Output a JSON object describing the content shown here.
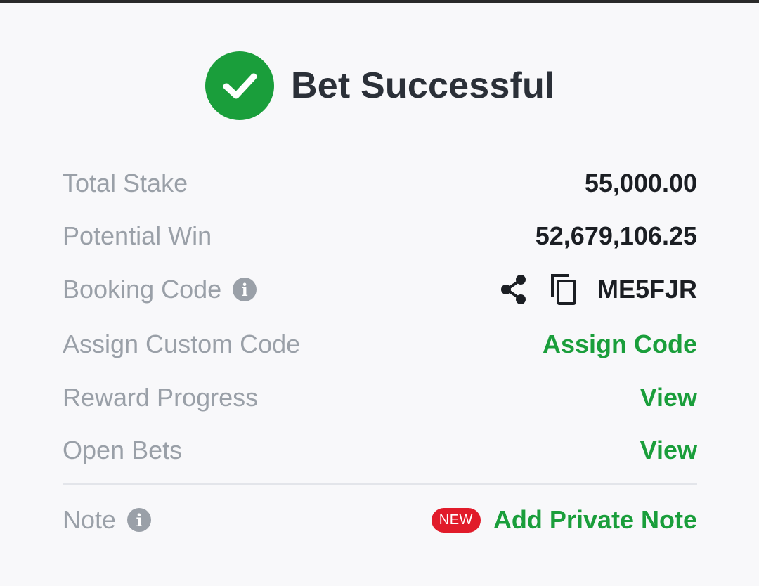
{
  "header": {
    "title": "Bet Successful"
  },
  "rows": {
    "total_stake": {
      "label": "Total Stake",
      "value": "55,000.00"
    },
    "potential_win": {
      "label": "Potential Win",
      "value": "52,679,106.25"
    },
    "booking_code": {
      "label": "Booking Code",
      "value": "ME5FJR"
    },
    "assign_custom_code": {
      "label": "Assign Custom Code",
      "action": "Assign Code"
    },
    "reward_progress": {
      "label": "Reward Progress",
      "action": "View"
    },
    "open_bets": {
      "label": "Open Bets",
      "action": "View"
    },
    "note": {
      "label": "Note",
      "badge": "NEW",
      "action": "Add Private Note"
    }
  },
  "icons": {
    "success": "check-circle-icon",
    "info": "info-icon",
    "share": "share-icon",
    "copy": "copy-icon"
  },
  "colors": {
    "accent_green": "#1a9e3b",
    "badge_red": "#e11b2a",
    "label_gray": "#9aa0a8",
    "value_dark": "#1b1e23"
  }
}
